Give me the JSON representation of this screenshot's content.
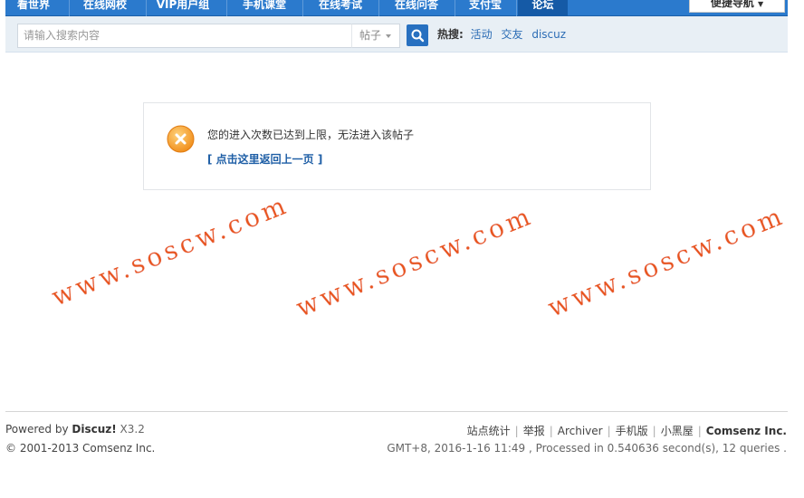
{
  "topnav": {
    "items": [
      {
        "label": "看世界"
      },
      {
        "label": "在线网校"
      },
      {
        "label": "VIP用户组"
      },
      {
        "label": "手机课堂"
      },
      {
        "label": "在线考试"
      },
      {
        "label": "在线问答"
      },
      {
        "label": "支付宝"
      },
      {
        "label": "论坛",
        "active": true
      }
    ],
    "quick_nav_label": "便捷导航",
    "colors": {
      "bar": "#2b7acd",
      "active": "#155aa6"
    }
  },
  "search": {
    "placeholder": "请输入搜索内容",
    "type_selected": "帖子",
    "search_icon": "search-icon",
    "hot_label": "热搜:",
    "hot_links": [
      "活动",
      "交友",
      "discuz"
    ]
  },
  "alert": {
    "icon": "error-x-icon",
    "message": "您的进入次数已达到上限，无法进入该帖子",
    "back_link": "[ 点击这里返回上一页 ]"
  },
  "watermark": {
    "text": "www.soscw.com",
    "color": "#e8541a"
  },
  "footer": {
    "powered_prefix": "Powered by ",
    "powered_brand": "Discuz!",
    "powered_version": " X3.2",
    "copyright": "© 2001-2013 Comsenz Inc.",
    "links": [
      {
        "label": "站点统计"
      },
      {
        "label": "举报"
      },
      {
        "label": "Archiver"
      },
      {
        "label": "手机版"
      },
      {
        "label": "小黑屋"
      },
      {
        "label": "Comsenz Inc.",
        "strong": true
      }
    ],
    "debug": "GMT+8, 2016-1-16 11:49 , Processed in 0.540636 second(s), 12 queries ."
  }
}
